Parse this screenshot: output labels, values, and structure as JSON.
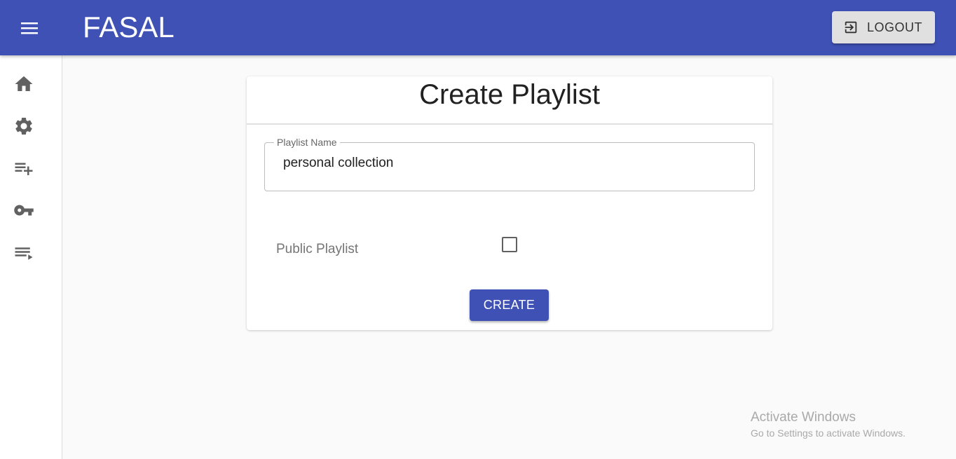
{
  "header": {
    "brand": "FASAL",
    "logout_label": "LOGOUT",
    "background_color": "#3f51b5",
    "icons": {
      "menu": "menu-icon",
      "logout": "logout-icon"
    }
  },
  "sidebar": {
    "items": [
      {
        "icon": "home-icon"
      },
      {
        "icon": "gear-icon"
      },
      {
        "icon": "playlist-add-icon"
      },
      {
        "icon": "key-icon"
      },
      {
        "icon": "playlist-play-icon"
      }
    ]
  },
  "form": {
    "title": "Create Playlist",
    "playlist_name_label": "Playlist Name",
    "playlist_name_value": "personal collection",
    "public_label": "Public Playlist",
    "public_checked": false,
    "create_label": "CREATE",
    "accent_color": "#3f51b5"
  },
  "watermark": {
    "line1": "Activate Windows",
    "line2": "Go to Settings to activate Windows."
  }
}
